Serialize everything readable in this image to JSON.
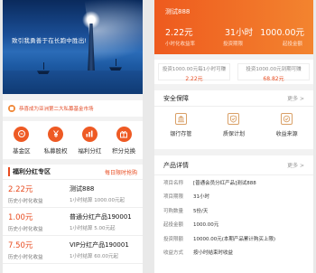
{
  "left": {
    "banner": {
      "slogan": "致引我勇善于在长跑中胜出!"
    },
    "notice": "恭喜成为亚洲第二大私募基金市场",
    "quick": [
      {
        "label": "基金区",
        "icon": "coin-icon"
      },
      {
        "label": "私募股权",
        "icon": "yen-icon"
      },
      {
        "label": "福利分红",
        "icon": "chart-icon"
      },
      {
        "label": "积分兑换",
        "icon": "gift-icon"
      }
    ],
    "zone": {
      "title": "福利分红专区",
      "more": "每日限时抢购",
      "items": [
        {
          "rate": "2.22元",
          "sub": "历史小时化收益",
          "name": "测试888",
          "detail": "1小时结算 1000.00元起"
        },
        {
          "rate": "1.00元",
          "sub": "历史小时化收益",
          "name": "普通分红产品190001",
          "detail": "1小时结算 5.00元起"
        },
        {
          "rate": "7.50元",
          "sub": "历史小时化收益",
          "name": "VIP分红产品190001",
          "detail": "1小时结算 60.00元起"
        }
      ]
    }
  },
  "right": {
    "hero": {
      "name": "测试888",
      "stats": [
        {
          "value": "2.22元",
          "label": "小时化收益率"
        },
        {
          "value": "31小时",
          "label": "投资期限"
        },
        {
          "value": "1000.00元",
          "label": "起投金额"
        }
      ]
    },
    "estimates": [
      {
        "text": "投资1000.00元每1小时可赚",
        "value": "2.22元"
      },
      {
        "text": "投资1000.00元到期可赚",
        "value": "68.82元"
      }
    ],
    "security": {
      "title": "安全保障",
      "more": "更多 >",
      "items": [
        {
          "label": "银行存管",
          "icon": "bank-icon"
        },
        {
          "label": "质保计划",
          "icon": "shield-icon"
        },
        {
          "label": "收益来源",
          "icon": "check-circle-icon"
        }
      ]
    },
    "details": {
      "title": "产品详情",
      "more": "更多 >",
      "rows": [
        {
          "key": "项目名称",
          "value": "[普通会员分红产品]测试888"
        },
        {
          "key": "项目期限",
          "value": "31小时"
        },
        {
          "key": "可购数量",
          "value": "5份/天"
        },
        {
          "key": "起投金额",
          "value": "1000.00元"
        },
        {
          "key": "投资限额",
          "value": "10000.00元(本期产品累计购买上限)"
        },
        {
          "key": "收益方式",
          "value": "按小时结束时收益"
        }
      ]
    }
  },
  "colors": {
    "accent": "#ee5a24",
    "brand_gradient_start": "#ee5a1e",
    "brand_gradient_end": "#f3842f"
  }
}
